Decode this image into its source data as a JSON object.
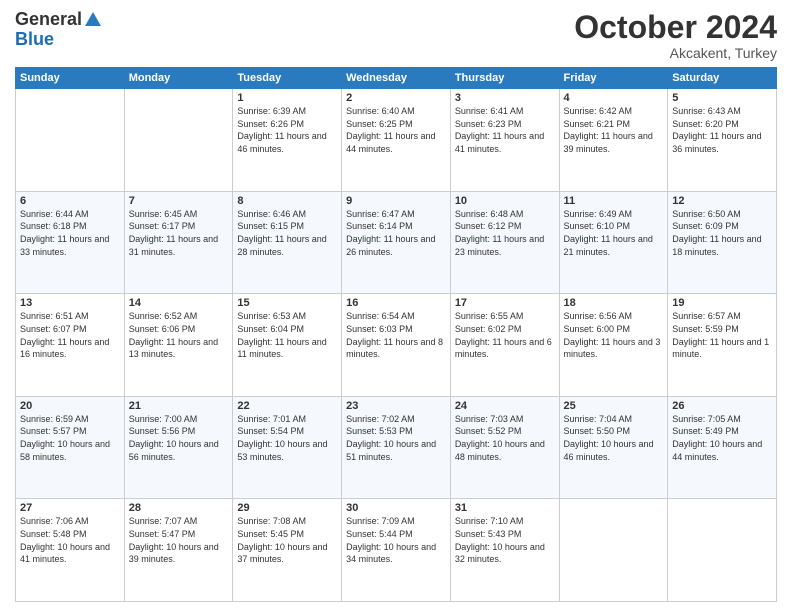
{
  "header": {
    "logo_general": "General",
    "logo_blue": "Blue",
    "month_title": "October 2024",
    "subtitle": "Akcakent, Turkey"
  },
  "days_of_week": [
    "Sunday",
    "Monday",
    "Tuesday",
    "Wednesday",
    "Thursday",
    "Friday",
    "Saturday"
  ],
  "weeks": [
    [
      {
        "day": "",
        "info": ""
      },
      {
        "day": "",
        "info": ""
      },
      {
        "day": "1",
        "info": "Sunrise: 6:39 AM\nSunset: 6:26 PM\nDaylight: 11 hours and 46 minutes."
      },
      {
        "day": "2",
        "info": "Sunrise: 6:40 AM\nSunset: 6:25 PM\nDaylight: 11 hours and 44 minutes."
      },
      {
        "day": "3",
        "info": "Sunrise: 6:41 AM\nSunset: 6:23 PM\nDaylight: 11 hours and 41 minutes."
      },
      {
        "day": "4",
        "info": "Sunrise: 6:42 AM\nSunset: 6:21 PM\nDaylight: 11 hours and 39 minutes."
      },
      {
        "day": "5",
        "info": "Sunrise: 6:43 AM\nSunset: 6:20 PM\nDaylight: 11 hours and 36 minutes."
      }
    ],
    [
      {
        "day": "6",
        "info": "Sunrise: 6:44 AM\nSunset: 6:18 PM\nDaylight: 11 hours and 33 minutes."
      },
      {
        "day": "7",
        "info": "Sunrise: 6:45 AM\nSunset: 6:17 PM\nDaylight: 11 hours and 31 minutes."
      },
      {
        "day": "8",
        "info": "Sunrise: 6:46 AM\nSunset: 6:15 PM\nDaylight: 11 hours and 28 minutes."
      },
      {
        "day": "9",
        "info": "Sunrise: 6:47 AM\nSunset: 6:14 PM\nDaylight: 11 hours and 26 minutes."
      },
      {
        "day": "10",
        "info": "Sunrise: 6:48 AM\nSunset: 6:12 PM\nDaylight: 11 hours and 23 minutes."
      },
      {
        "day": "11",
        "info": "Sunrise: 6:49 AM\nSunset: 6:10 PM\nDaylight: 11 hours and 21 minutes."
      },
      {
        "day": "12",
        "info": "Sunrise: 6:50 AM\nSunset: 6:09 PM\nDaylight: 11 hours and 18 minutes."
      }
    ],
    [
      {
        "day": "13",
        "info": "Sunrise: 6:51 AM\nSunset: 6:07 PM\nDaylight: 11 hours and 16 minutes."
      },
      {
        "day": "14",
        "info": "Sunrise: 6:52 AM\nSunset: 6:06 PM\nDaylight: 11 hours and 13 minutes."
      },
      {
        "day": "15",
        "info": "Sunrise: 6:53 AM\nSunset: 6:04 PM\nDaylight: 11 hours and 11 minutes."
      },
      {
        "day": "16",
        "info": "Sunrise: 6:54 AM\nSunset: 6:03 PM\nDaylight: 11 hours and 8 minutes."
      },
      {
        "day": "17",
        "info": "Sunrise: 6:55 AM\nSunset: 6:02 PM\nDaylight: 11 hours and 6 minutes."
      },
      {
        "day": "18",
        "info": "Sunrise: 6:56 AM\nSunset: 6:00 PM\nDaylight: 11 hours and 3 minutes."
      },
      {
        "day": "19",
        "info": "Sunrise: 6:57 AM\nSunset: 5:59 PM\nDaylight: 11 hours and 1 minute."
      }
    ],
    [
      {
        "day": "20",
        "info": "Sunrise: 6:59 AM\nSunset: 5:57 PM\nDaylight: 10 hours and 58 minutes."
      },
      {
        "day": "21",
        "info": "Sunrise: 7:00 AM\nSunset: 5:56 PM\nDaylight: 10 hours and 56 minutes."
      },
      {
        "day": "22",
        "info": "Sunrise: 7:01 AM\nSunset: 5:54 PM\nDaylight: 10 hours and 53 minutes."
      },
      {
        "day": "23",
        "info": "Sunrise: 7:02 AM\nSunset: 5:53 PM\nDaylight: 10 hours and 51 minutes."
      },
      {
        "day": "24",
        "info": "Sunrise: 7:03 AM\nSunset: 5:52 PM\nDaylight: 10 hours and 48 minutes."
      },
      {
        "day": "25",
        "info": "Sunrise: 7:04 AM\nSunset: 5:50 PM\nDaylight: 10 hours and 46 minutes."
      },
      {
        "day": "26",
        "info": "Sunrise: 7:05 AM\nSunset: 5:49 PM\nDaylight: 10 hours and 44 minutes."
      }
    ],
    [
      {
        "day": "27",
        "info": "Sunrise: 7:06 AM\nSunset: 5:48 PM\nDaylight: 10 hours and 41 minutes."
      },
      {
        "day": "28",
        "info": "Sunrise: 7:07 AM\nSunset: 5:47 PM\nDaylight: 10 hours and 39 minutes."
      },
      {
        "day": "29",
        "info": "Sunrise: 7:08 AM\nSunset: 5:45 PM\nDaylight: 10 hours and 37 minutes."
      },
      {
        "day": "30",
        "info": "Sunrise: 7:09 AM\nSunset: 5:44 PM\nDaylight: 10 hours and 34 minutes."
      },
      {
        "day": "31",
        "info": "Sunrise: 7:10 AM\nSunset: 5:43 PM\nDaylight: 10 hours and 32 minutes."
      },
      {
        "day": "",
        "info": ""
      },
      {
        "day": "",
        "info": ""
      }
    ]
  ]
}
